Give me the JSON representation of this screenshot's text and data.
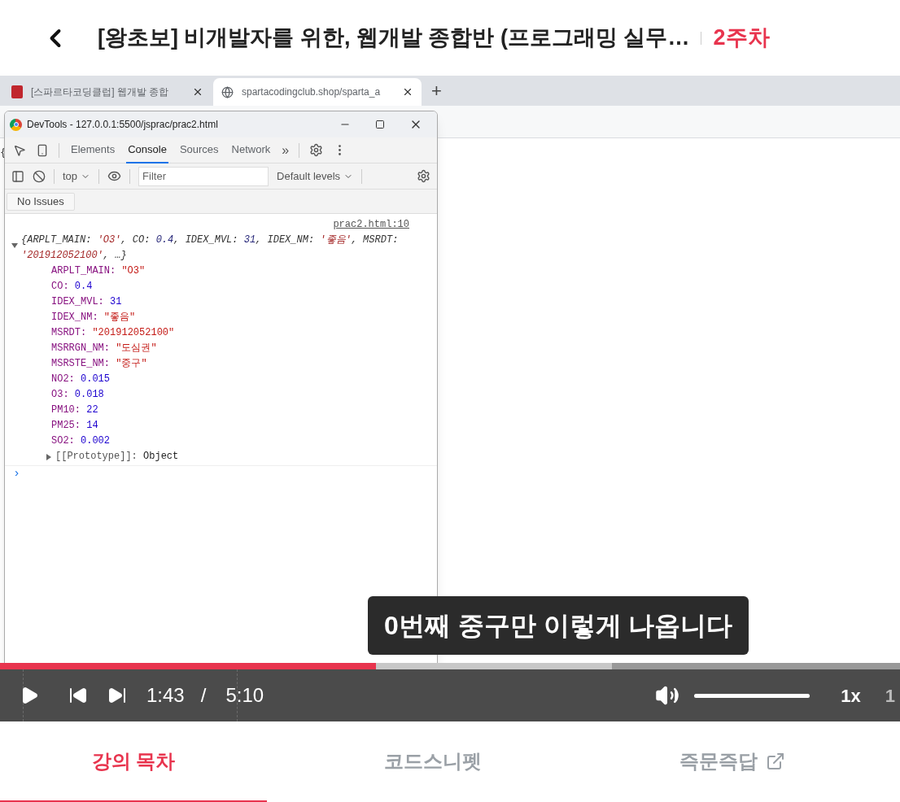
{
  "header": {
    "title": "[왕초보] 비개발자를 위한, 웹개발 종합반 (프로그래밍 실무…",
    "week": "2주차"
  },
  "browser": {
    "tabs": [
      {
        "label": "[스파르타코딩클럽] 웹개발 종합",
        "selected": false,
        "kind": "book"
      },
      {
        "label": "spartacodingclub.shop/sparta_a",
        "selected": true,
        "kind": "globe"
      }
    ],
    "new_tab": "+",
    "page_text": "{"
  },
  "devtools": {
    "title": "DevTools - 127.0.0.1:5500/jsprac/prac2.html",
    "tabs": [
      {
        "label": "Elements",
        "selected": false
      },
      {
        "label": "Console",
        "selected": true
      },
      {
        "label": "Sources",
        "selected": false
      },
      {
        "label": "Network",
        "selected": false
      }
    ],
    "more_tabs": "»",
    "context": "top",
    "filter": {
      "placeholder": "Filter"
    },
    "levels": "Default levels",
    "issues": "No Issues",
    "source_link": "prac2.html:10",
    "summary": {
      "expanded": true,
      "segments": [
        {
          "text": "{ARPLT_MAIN: ",
          "kind": "key"
        },
        {
          "text": "'O3'",
          "kind": "string"
        },
        {
          "text": ", CO: ",
          "kind": "key"
        },
        {
          "text": "0.4",
          "kind": "number"
        },
        {
          "text": ", IDEX_MVL: ",
          "kind": "key"
        },
        {
          "text": "31",
          "kind": "number"
        },
        {
          "text": ", IDEX_NM: ",
          "kind": "key"
        },
        {
          "text": "'좋음'",
          "kind": "string"
        },
        {
          "text": ", MSRDT: ",
          "kind": "key"
        },
        {
          "text": "'201912052100'",
          "kind": "string"
        },
        {
          "text": ", …}",
          "kind": "key"
        }
      ]
    },
    "properties": [
      {
        "key": "ARPLT_MAIN:",
        "value": "\"O3\"",
        "kind": "string"
      },
      {
        "key": "CO:",
        "value": "0.4",
        "kind": "number"
      },
      {
        "key": "IDEX_MVL:",
        "value": "31",
        "kind": "number"
      },
      {
        "key": "IDEX_NM:",
        "value": "\"좋음\"",
        "kind": "string"
      },
      {
        "key": "MSRDT:",
        "value": "\"201912052100\"",
        "kind": "string"
      },
      {
        "key": "MSRRGN_NM:",
        "value": "\"도심권\"",
        "kind": "string"
      },
      {
        "key": "MSRSTE_NM:",
        "value": "\"중구\"",
        "kind": "string"
      },
      {
        "key": "NO2:",
        "value": "0.015",
        "kind": "number"
      },
      {
        "key": "O3:",
        "value": "0.018",
        "kind": "number"
      },
      {
        "key": "PM10:",
        "value": "22",
        "kind": "number"
      },
      {
        "key": "PM25:",
        "value": "14",
        "kind": "number"
      },
      {
        "key": "SO2:",
        "value": "0.002",
        "kind": "number"
      }
    ],
    "prototype": {
      "key": "[[Prototype]]:",
      "value": "Object",
      "expanded": false
    },
    "prompt": "›"
  },
  "subtitle": "0번째 중구만 이렇게 나옵니다",
  "player": {
    "progress": {
      "level": 0.418
    },
    "buffered": {
      "level": 0.68
    },
    "current_time": "1:43",
    "separator": "/",
    "duration": "5:10",
    "volume": {
      "level": 1
    },
    "speed": "1x",
    "edge_text": "1"
  },
  "bottom_tabs": [
    {
      "label": "강의 목차",
      "selected": true,
      "external": false
    },
    {
      "label": "코드스니펫",
      "selected": false,
      "external": false
    },
    {
      "label": "즉문즉답",
      "selected": false,
      "external": true
    }
  ]
}
